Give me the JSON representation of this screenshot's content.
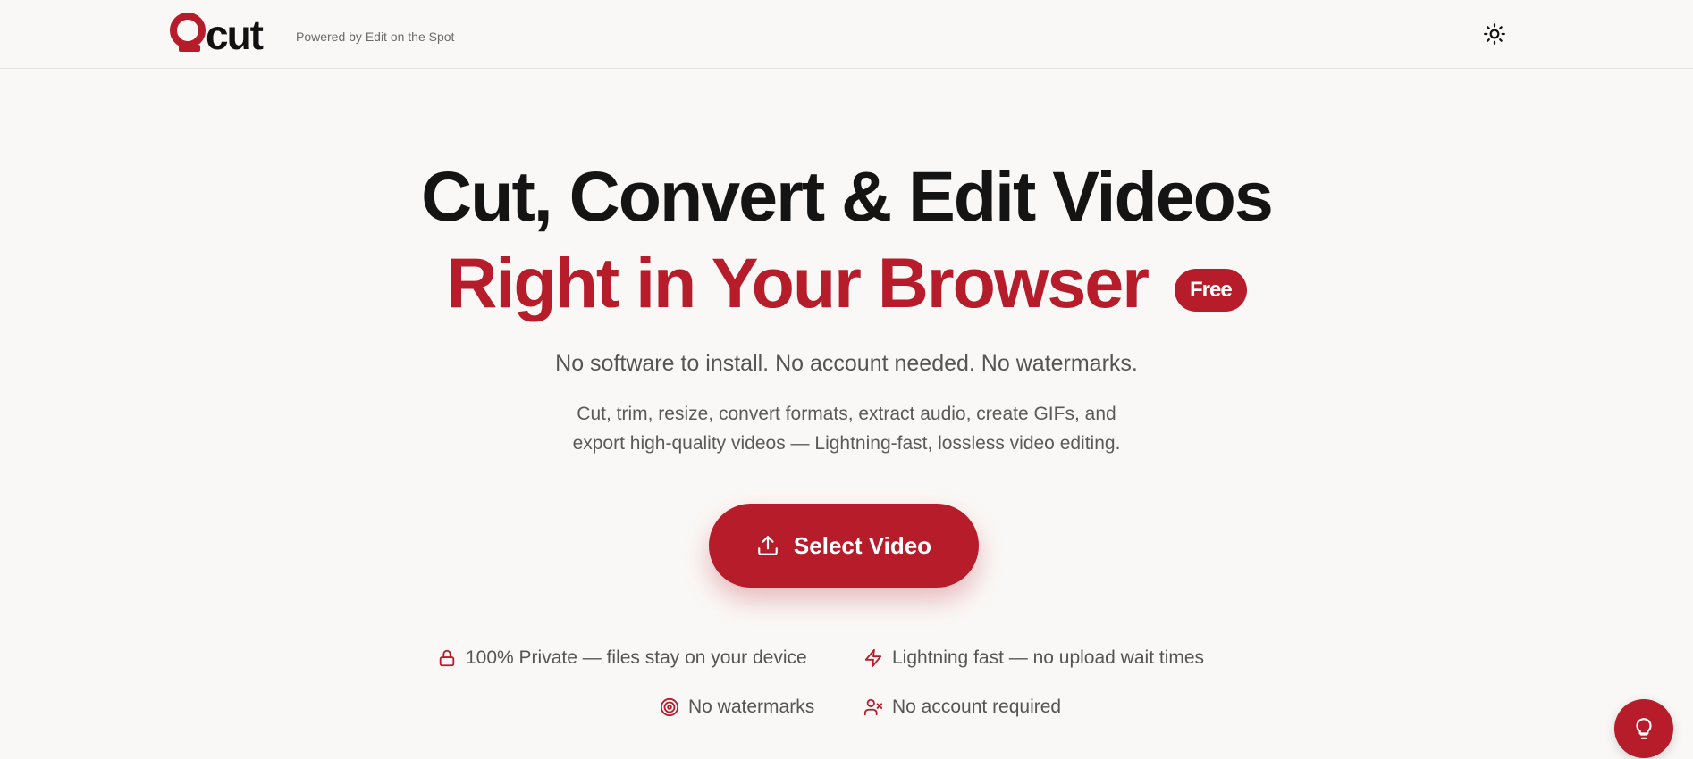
{
  "header": {
    "logo_text": "Qcut",
    "powered_by": "Powered by Edit on the Spot",
    "theme_toggle_icon": "sun-icon"
  },
  "hero": {
    "line1": "Cut, Convert & Edit Videos",
    "line2": "Right in Your Browser",
    "badge": "Free",
    "subtitle": "No software to install. No account needed. No watermarks.",
    "description_line1": "Cut, trim, resize, convert formats, extract audio, create GIFs, and",
    "description_line2": "export high-quality videos — Lightning-fast, lossless video editing."
  },
  "cta": {
    "label": "Select Video",
    "icon": "upload-icon"
  },
  "features": [
    {
      "icon": "lock-icon",
      "label": "100% Private — files stay on your device"
    },
    {
      "icon": "lightning-icon",
      "label": "Lightning fast — no upload wait times"
    },
    {
      "icon": "target-icon",
      "label": "No watermarks"
    },
    {
      "icon": "user-x-icon",
      "label": "No account required"
    }
  ],
  "help": {
    "icon": "lightbulb-icon"
  },
  "colors": {
    "accent": "#b71c2a",
    "background": "#faf8f6",
    "text": "#141414",
    "muted": "#555555"
  }
}
